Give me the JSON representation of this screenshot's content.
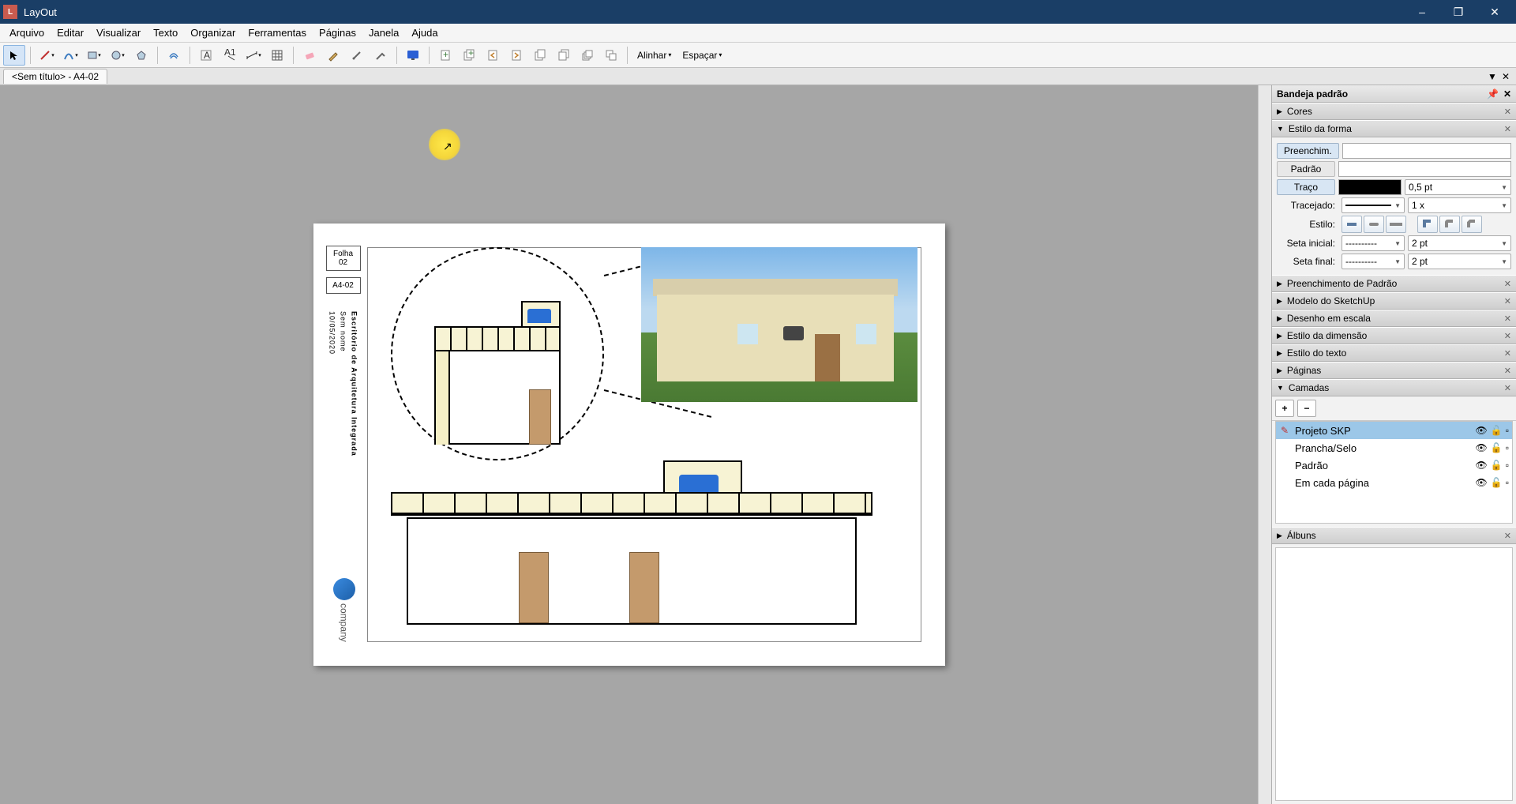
{
  "app": {
    "title": "LayOut"
  },
  "menu": [
    "Arquivo",
    "Editar",
    "Visualizar",
    "Texto",
    "Organizar",
    "Ferramentas",
    "Páginas",
    "Janela",
    "Ajuda"
  ],
  "toolbar_text": {
    "align": "Alinhar",
    "space": "Espaçar"
  },
  "tab": {
    "label": "<Sem título> - A4-02"
  },
  "tray": {
    "title": "Bandeja padrão",
    "panels": {
      "cores": "Cores",
      "estilo_forma": "Estilo da forma",
      "preench_padrao": "Preenchimento de Padrão",
      "modelo_sketchup": "Modelo do SketchUp",
      "desenho_escala": "Desenho em escala",
      "estilo_dimensao": "Estilo da dimensão",
      "estilo_texto": "Estilo do texto",
      "paginas": "Páginas",
      "camadas": "Camadas",
      "albuns": "Álbuns"
    }
  },
  "shape_style": {
    "fill_btn": "Preenchim.",
    "pattern_btn": "Padrão",
    "stroke_btn": "Traço",
    "stroke_width": "0,5 pt",
    "dashes_label": "Tracejado:",
    "dashes_scale": "1 x",
    "style_label": "Estilo:",
    "arrow_start_label": "Seta inicial:",
    "arrow_end_label": "Seta final:",
    "arrow_size": "2 pt",
    "dash_sel": "----------"
  },
  "layers": {
    "items": [
      "Projeto SKP",
      "Prancha/Selo",
      "Padrão",
      "Em cada página"
    ],
    "selected_index": 0
  },
  "page": {
    "sheet_box1": "Folha 02",
    "sheet_box2": "A4-02",
    "title_vert": "Escritório de Arquitetura Integrada",
    "subtitle_vert": "Sem nome",
    "date_vert": "10/05/2020",
    "logo_text": "company"
  }
}
